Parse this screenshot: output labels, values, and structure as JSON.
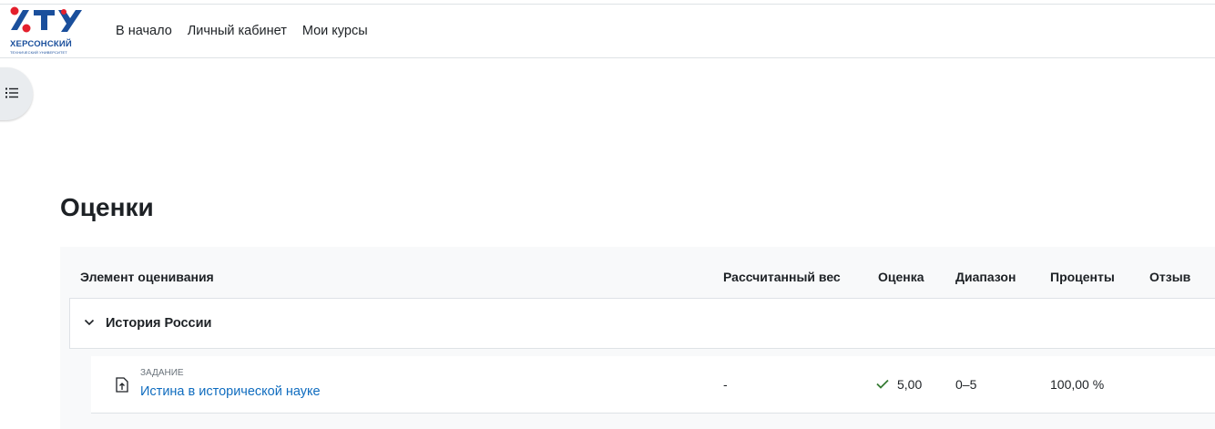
{
  "logo": {
    "name": "ХЕРСОНСКИЙ",
    "subtitle": "технический университет"
  },
  "nav": {
    "items": [
      "В начало",
      "Личный кабинет",
      "Мои курсы"
    ]
  },
  "page": {
    "title": "Оценки"
  },
  "table": {
    "headers": {
      "item": "Элемент оценивания",
      "weight": "Рассчитанный вес",
      "grade": "Оценка",
      "range": "Диапазон",
      "percent": "Проценты",
      "feedback": "Отзыв"
    },
    "category": {
      "name": "История России"
    },
    "rows": [
      {
        "type": "Задание",
        "name": "Истина в исторической науке",
        "weight": "-",
        "grade": "5,00",
        "range": "0–5",
        "percent": "100,00 %",
        "feedback": ""
      }
    ]
  },
  "colors": {
    "link": "#0f6cbf",
    "success": "#357a32",
    "logo_blue": "#1a4f9c",
    "logo_red": "#e4202d",
    "panel_bg": "#f8f9fa",
    "border": "#dee2e6"
  },
  "icons": {
    "drawer": "list-icon",
    "category": "chevron-down-icon",
    "assignment": "assignment-upload-icon",
    "graded": "check-icon"
  }
}
